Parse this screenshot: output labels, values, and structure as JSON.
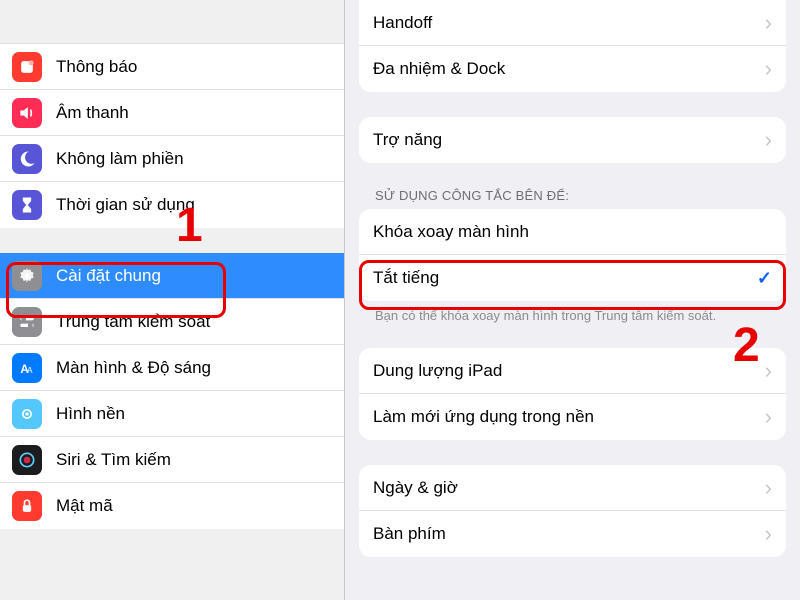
{
  "sidebar": {
    "group1": {
      "notifications": {
        "label": "Thông báo"
      },
      "sounds": {
        "label": "Âm thanh"
      },
      "dnd": {
        "label": "Không làm phiền"
      },
      "screentime": {
        "label": "Thời gian sử dụng"
      }
    },
    "group2": {
      "general": {
        "label": "Cài đặt chung"
      },
      "control": {
        "label": "Trung tâm kiểm soát"
      },
      "display": {
        "label": "Màn hình & Độ sáng"
      },
      "wallpaper": {
        "label": "Hình nền"
      },
      "siri": {
        "label": "Siri & Tìm kiếm"
      },
      "passcode": {
        "label": "Mật mã"
      }
    }
  },
  "detail": {
    "group1": {
      "handoff": {
        "label": "Handoff"
      },
      "multitask": {
        "label": "Đa nhiệm & Dock"
      }
    },
    "group2": {
      "accessibility": {
        "label": "Trợ năng"
      }
    },
    "sideswitch": {
      "header": "SỬ DỤNG CÔNG TẮC BÊN ĐỂ:",
      "lock": {
        "label": "Khóa xoay màn hình"
      },
      "mute": {
        "label": "Tắt tiếng"
      },
      "footer": "Bạn có thể khóa xoay màn hình trong Trung tâm kiểm soát."
    },
    "group4": {
      "storage": {
        "label": "Dung lượng iPad"
      },
      "bgapp": {
        "label": "Làm mới ứng dụng trong nền"
      }
    },
    "group5": {
      "datetime": {
        "label": "Ngày & giờ"
      },
      "keyboard": {
        "label": "Bàn phím"
      }
    }
  },
  "annotations": {
    "one": "1",
    "two": "2"
  }
}
